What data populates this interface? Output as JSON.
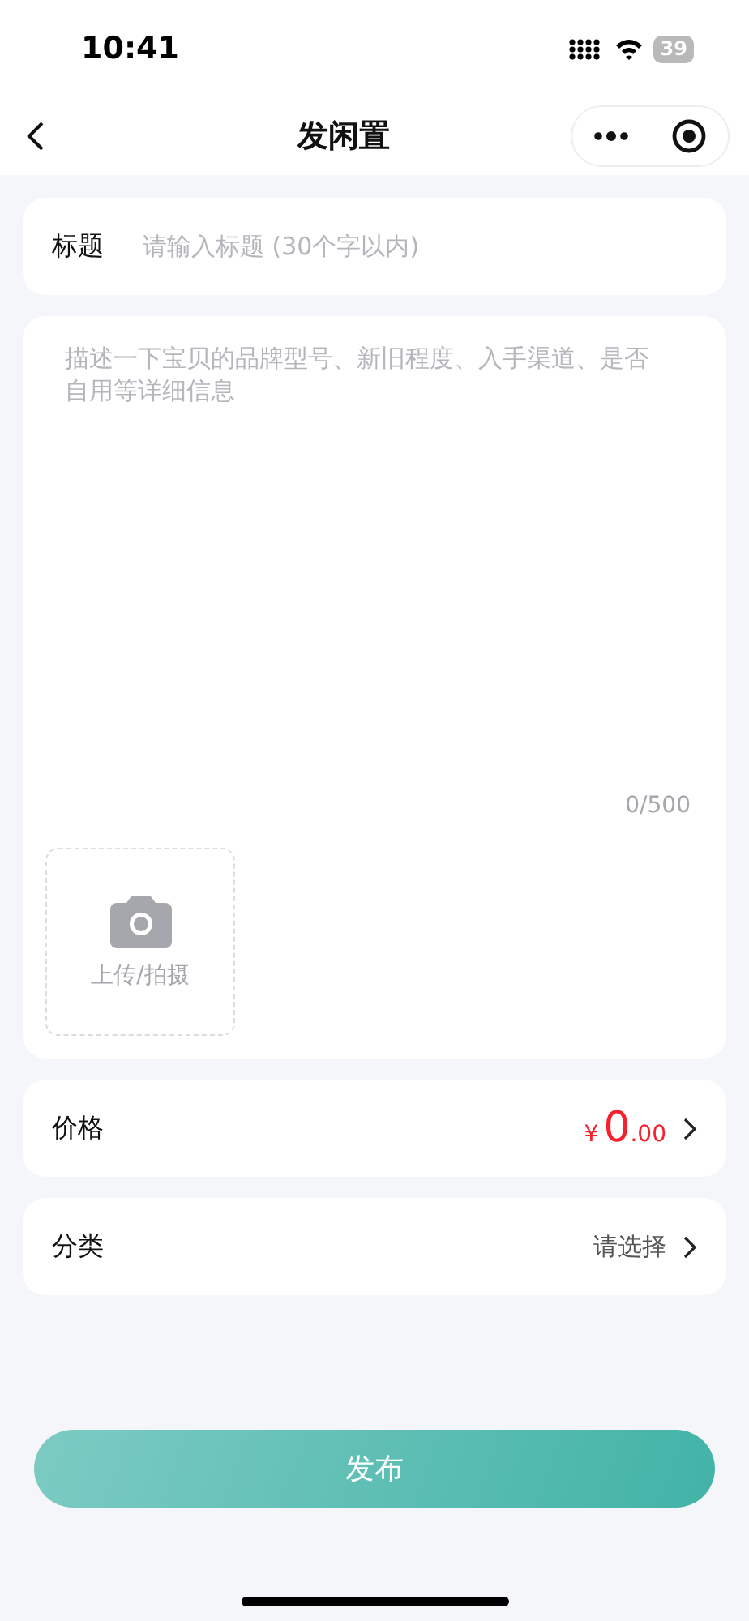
{
  "status_bar": {
    "time": "10:41",
    "battery": "39"
  },
  "nav": {
    "title": "发闲置"
  },
  "title_field": {
    "label": "标题",
    "placeholder": "请输入标题 (30个字以内)"
  },
  "description": {
    "placeholder": "描述一下宝贝的品牌型号、新旧程度、入手渠道、是否自用等详细信息",
    "counter": "0/500",
    "upload_label": "上传/拍摄"
  },
  "rows": [
    {
      "kind": "price",
      "label": "价格",
      "currency": "¥",
      "integer": "0",
      "decimals": ".00"
    },
    {
      "kind": "select",
      "label": "分类",
      "value": "请选择"
    }
  ],
  "submit": {
    "label": "发布"
  }
}
